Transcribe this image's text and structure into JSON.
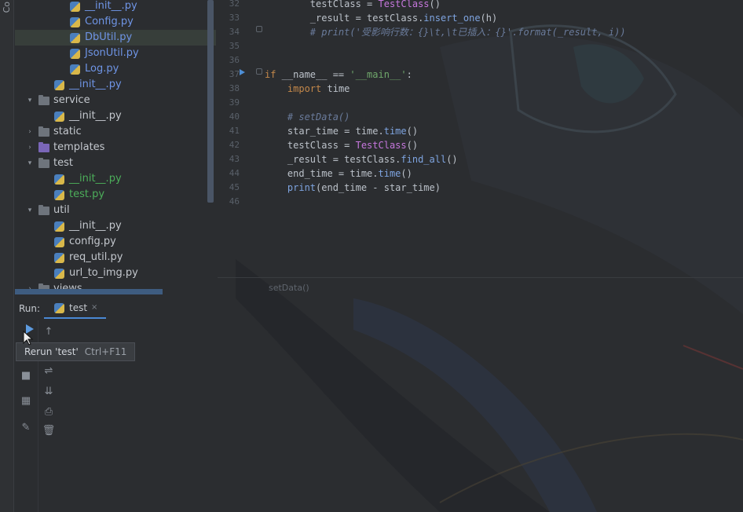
{
  "side_stripe": {
    "label": "Co"
  },
  "project_tree": {
    "items": [
      {
        "label": "__init__.py",
        "type": "py",
        "color": "blue",
        "indent": 3
      },
      {
        "label": "Config.py",
        "type": "py",
        "color": "blue",
        "indent": 3
      },
      {
        "label": "DbUtil.py",
        "type": "py",
        "color": "blue",
        "indent": 3,
        "selected": true
      },
      {
        "label": "JsonUtil.py",
        "type": "py",
        "color": "blue",
        "indent": 3
      },
      {
        "label": "Log.py",
        "type": "py",
        "color": "blue",
        "indent": 3
      },
      {
        "label": "__init__.py",
        "type": "py",
        "color": "blue",
        "indent": 2
      },
      {
        "label": "service",
        "type": "folder",
        "expanded": true,
        "indent": 1
      },
      {
        "label": "__init__.py",
        "type": "py",
        "color": "gray",
        "indent": 2
      },
      {
        "label": "static",
        "type": "folder",
        "indent": 1
      },
      {
        "label": "templates",
        "type": "folder-purple",
        "indent": 1
      },
      {
        "label": "test",
        "type": "folder",
        "expanded": true,
        "indent": 1
      },
      {
        "label": "__init__.py",
        "type": "py",
        "color": "green",
        "indent": 2
      },
      {
        "label": "test.py",
        "type": "py",
        "color": "green",
        "indent": 2
      },
      {
        "label": "util",
        "type": "folder",
        "expanded": true,
        "indent": 1
      },
      {
        "label": "__init__.py",
        "type": "py",
        "color": "gray",
        "indent": 2
      },
      {
        "label": "config.py",
        "type": "py",
        "color": "gray",
        "indent": 2
      },
      {
        "label": "req_util.py",
        "type": "py",
        "color": "gray",
        "indent": 2
      },
      {
        "label": "url_to_img.py",
        "type": "py",
        "color": "gray",
        "indent": 2
      },
      {
        "label": "views",
        "type": "folder",
        "indent": 1
      }
    ]
  },
  "editor": {
    "line_numbers": [
      "32",
      "33",
      "34",
      "35",
      "36",
      "37",
      "38",
      "39",
      "40",
      "41",
      "42",
      "43",
      "44",
      "45",
      "46"
    ],
    "lines": [
      [
        {
          "t": "        testClass = "
        },
        {
          "t": "TestClass",
          "c": "cls"
        },
        {
          "t": "()"
        }
      ],
      [
        {
          "t": "        _result = testClass."
        },
        {
          "t": "insert_one",
          "c": "fn"
        },
        {
          "t": "(h)"
        }
      ],
      [
        {
          "t": "        # print('受影响行数：{}\\t,\\t已插入：{}'.format(_result, i))",
          "c": "cm"
        }
      ],
      [
        {
          "t": ""
        }
      ],
      [
        {
          "t": ""
        }
      ],
      [
        {
          "t": "if",
          "c": "kw"
        },
        {
          "t": " __name__ == "
        },
        {
          "t": "'__main__'",
          "c": "str"
        },
        {
          "t": ":"
        }
      ],
      [
        {
          "t": "    "
        },
        {
          "t": "import",
          "c": "kw"
        },
        {
          "t": " time"
        }
      ],
      [
        {
          "t": ""
        }
      ],
      [
        {
          "t": "    # setData()",
          "c": "cm"
        }
      ],
      [
        {
          "t": "    star_time = time."
        },
        {
          "t": "time",
          "c": "fn"
        },
        {
          "t": "()"
        }
      ],
      [
        {
          "t": "    testClass = "
        },
        {
          "t": "TestClass",
          "c": "cls"
        },
        {
          "t": "()"
        }
      ],
      [
        {
          "t": "    _result = testClass."
        },
        {
          "t": "find_all",
          "c": "fn"
        },
        {
          "t": "()"
        }
      ],
      [
        {
          "t": "    end_time = time."
        },
        {
          "t": "time",
          "c": "fn"
        },
        {
          "t": "()"
        }
      ],
      [
        {
          "t": "    "
        },
        {
          "t": "print",
          "c": "fn"
        },
        {
          "t": "(end_time - star_time)"
        }
      ],
      [
        {
          "t": ""
        }
      ]
    ],
    "breadcrumb": "setData()"
  },
  "run_panel": {
    "title": "Run:",
    "tab_label": "test",
    "tab_close": "×",
    "tooltip_text": "Rerun 'test'",
    "tooltip_shortcut": "Ctrl+F11"
  }
}
